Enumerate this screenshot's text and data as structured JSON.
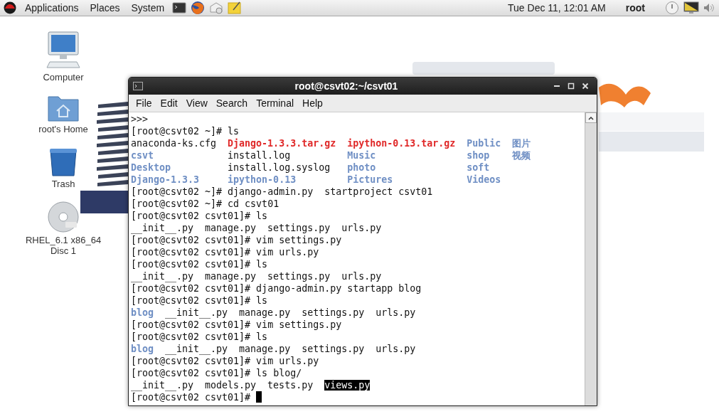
{
  "top_panel": {
    "menus": [
      "Applications",
      "Places",
      "System"
    ],
    "clock": "Tue Dec 11, 12:01 AM",
    "user": "root"
  },
  "desktop_icons": [
    {
      "label": "Computer",
      "kind": "computer"
    },
    {
      "label": "root's Home",
      "kind": "home"
    },
    {
      "label": "Trash",
      "kind": "trash"
    },
    {
      "label": "RHEL_6.1 x86_64 Disc 1",
      "kind": "disc"
    }
  ],
  "terminal": {
    "title": "root@csvt02:~/csvt01",
    "menus": [
      "File",
      "Edit",
      "View",
      "Search",
      "Terminal",
      "Help"
    ],
    "lines": [
      {
        "kind": "output",
        "text": ">>>"
      },
      {
        "kind": "command",
        "text": "[root@csvt02 ~]# ls"
      },
      {
        "kind": "listing",
        "columns": [
          [
            {
              "name": "anaconda-ks.cfg",
              "kind": "file",
              "selected": false
            },
            {
              "name": "csvt",
              "kind": "directory",
              "selected": false
            },
            {
              "name": "Desktop",
              "kind": "directory",
              "selected": false
            },
            {
              "name": "Django-1.3.3",
              "kind": "directory",
              "selected": false
            }
          ],
          [
            {
              "name": "Django-1.3.3.tar.gz",
              "kind": "archive",
              "selected": false
            },
            {
              "name": "install.log",
              "kind": "file",
              "selected": false
            },
            {
              "name": "install.log.syslog",
              "kind": "file",
              "selected": false
            },
            {
              "name": "ipython-0.13",
              "kind": "directory",
              "selected": false
            }
          ],
          [
            {
              "name": "ipython-0.13.tar.gz",
              "kind": "archive",
              "selected": false
            },
            {
              "name": "Music",
              "kind": "directory",
              "selected": false
            },
            {
              "name": "photo",
              "kind": "directory",
              "selected": false
            },
            {
              "name": "Pictures",
              "kind": "directory",
              "selected": false
            }
          ],
          [
            {
              "name": "Public",
              "kind": "directory",
              "selected": false
            },
            {
              "name": "shop",
              "kind": "directory",
              "selected": false
            },
            {
              "name": "soft",
              "kind": "directory",
              "selected": false
            },
            {
              "name": "Videos",
              "kind": "directory",
              "selected": false
            }
          ],
          [
            {
              "name": "图片",
              "kind": "directory",
              "selected": false
            },
            {
              "name": "视频",
              "kind": "directory",
              "selected": false
            }
          ]
        ]
      },
      {
        "kind": "command",
        "text": "[root@csvt02 ~]# django-admin.py  startproject csvt01"
      },
      {
        "kind": "command",
        "text": "[root@csvt02 ~]# cd csvt01"
      },
      {
        "kind": "command",
        "text": "[root@csvt02 csvt01]# ls"
      },
      {
        "kind": "listing",
        "columns": [
          [
            {
              "name": "__init__.py",
              "kind": "file",
              "selected": false
            }
          ],
          [
            {
              "name": "manage.py",
              "kind": "file",
              "selected": false
            }
          ],
          [
            {
              "name": "settings.py",
              "kind": "file",
              "selected": false
            }
          ],
          [
            {
              "name": "urls.py",
              "kind": "file",
              "selected": false
            }
          ]
        ]
      },
      {
        "kind": "command",
        "text": "[root@csvt02 csvt01]# vim settings.py"
      },
      {
        "kind": "command",
        "text": "[root@csvt02 csvt01]# vim urls.py"
      },
      {
        "kind": "command",
        "text": "[root@csvt02 csvt01]# ls"
      },
      {
        "kind": "listing",
        "columns": [
          [
            {
              "name": "__init__.py",
              "kind": "file",
              "selected": false
            }
          ],
          [
            {
              "name": "manage.py",
              "kind": "file",
              "selected": false
            }
          ],
          [
            {
              "name": "settings.py",
              "kind": "file",
              "selected": false
            }
          ],
          [
            {
              "name": "urls.py",
              "kind": "file",
              "selected": false
            }
          ]
        ]
      },
      {
        "kind": "command",
        "text": "[root@csvt02 csvt01]# django-admin.py startapp blog"
      },
      {
        "kind": "command",
        "text": "[root@csvt02 csvt01]# ls"
      },
      {
        "kind": "listing",
        "columns": [
          [
            {
              "name": "blog",
              "kind": "directory",
              "selected": false
            }
          ],
          [
            {
              "name": "__init__.py",
              "kind": "file",
              "selected": false
            }
          ],
          [
            {
              "name": "manage.py",
              "kind": "file",
              "selected": false
            }
          ],
          [
            {
              "name": "settings.py",
              "kind": "file",
              "selected": false
            }
          ],
          [
            {
              "name": "urls.py",
              "kind": "file",
              "selected": false
            }
          ]
        ]
      },
      {
        "kind": "command",
        "text": "[root@csvt02 csvt01]# vim settings.py"
      },
      {
        "kind": "command",
        "text": "[root@csvt02 csvt01]# ls"
      },
      {
        "kind": "listing",
        "columns": [
          [
            {
              "name": "blog",
              "kind": "directory",
              "selected": false
            }
          ],
          [
            {
              "name": "__init__.py",
              "kind": "file",
              "selected": false
            }
          ],
          [
            {
              "name": "manage.py",
              "kind": "file",
              "selected": false
            }
          ],
          [
            {
              "name": "settings.py",
              "kind": "file",
              "selected": false
            }
          ],
          [
            {
              "name": "urls.py",
              "kind": "file",
              "selected": false
            }
          ]
        ]
      },
      {
        "kind": "command",
        "text": "[root@csvt02 csvt01]# vim urls.py"
      },
      {
        "kind": "command",
        "text": "[root@csvt02 csvt01]# ls blog/"
      },
      {
        "kind": "listing",
        "columns": [
          [
            {
              "name": "__init__.py",
              "kind": "file",
              "selected": false
            }
          ],
          [
            {
              "name": "models.py",
              "kind": "file",
              "selected": false
            }
          ],
          [
            {
              "name": "tests.py",
              "kind": "file",
              "selected": false
            }
          ],
          [
            {
              "name": "views.py",
              "kind": "file",
              "selected": true
            }
          ]
        ]
      },
      {
        "kind": "command",
        "text": "[root@csvt02 csvt01]#",
        "cursor": true
      }
    ]
  }
}
